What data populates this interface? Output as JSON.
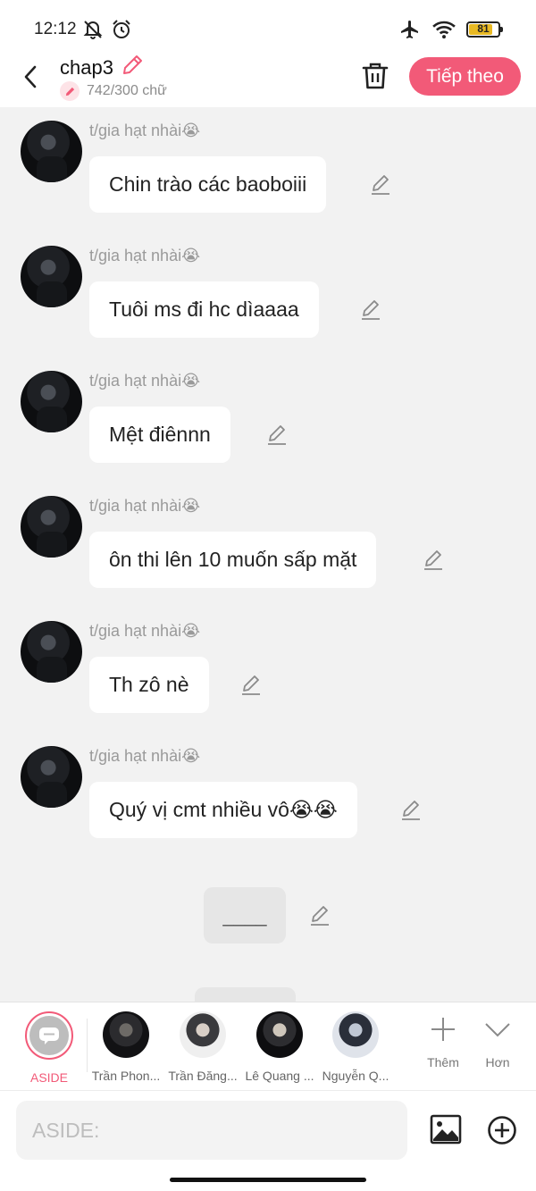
{
  "status_bar": {
    "time": "12:12",
    "battery_level": "81",
    "icons": [
      "mute-icon",
      "alarm-icon",
      "airplane-icon",
      "wifi-icon",
      "battery-icon"
    ]
  },
  "header": {
    "title": "chap3",
    "word_count": "742/300 chữ",
    "next_label": "Tiếp theo"
  },
  "messages": [
    {
      "sender": "t/gia hạt nhài😭",
      "text": "Chin trào các baoboiii"
    },
    {
      "sender": "t/gia hạt nhài😭",
      "text": "Tuôi ms đi hc dìaaaa"
    },
    {
      "sender": "t/gia hạt nhài😭",
      "text": "Mệt điênnn"
    },
    {
      "sender": "t/gia hạt nhài😭",
      "text": "ôn thi lên 10 muốn sấp mặt"
    },
    {
      "sender": "t/gia hạt nhài😭",
      "text": "Th zô nè"
    },
    {
      "sender": "t/gia hạt nhài😭",
      "text": "Quý vị cmt nhiều vô😭😭"
    }
  ],
  "divider_text": "____",
  "characters": {
    "aside_label": "ASIDE",
    "items": [
      {
        "name": "Trần Phon..."
      },
      {
        "name": "Trần Đăng..."
      },
      {
        "name": "Lê Quang ..."
      },
      {
        "name": "Nguyễn Q..."
      }
    ],
    "add_label": "Thêm",
    "more_label": "Hơn"
  },
  "input": {
    "placeholder": "ASIDE:"
  },
  "colors": {
    "accent": "#f25a78",
    "background": "#f2f2f2",
    "bubble": "#ffffff"
  }
}
